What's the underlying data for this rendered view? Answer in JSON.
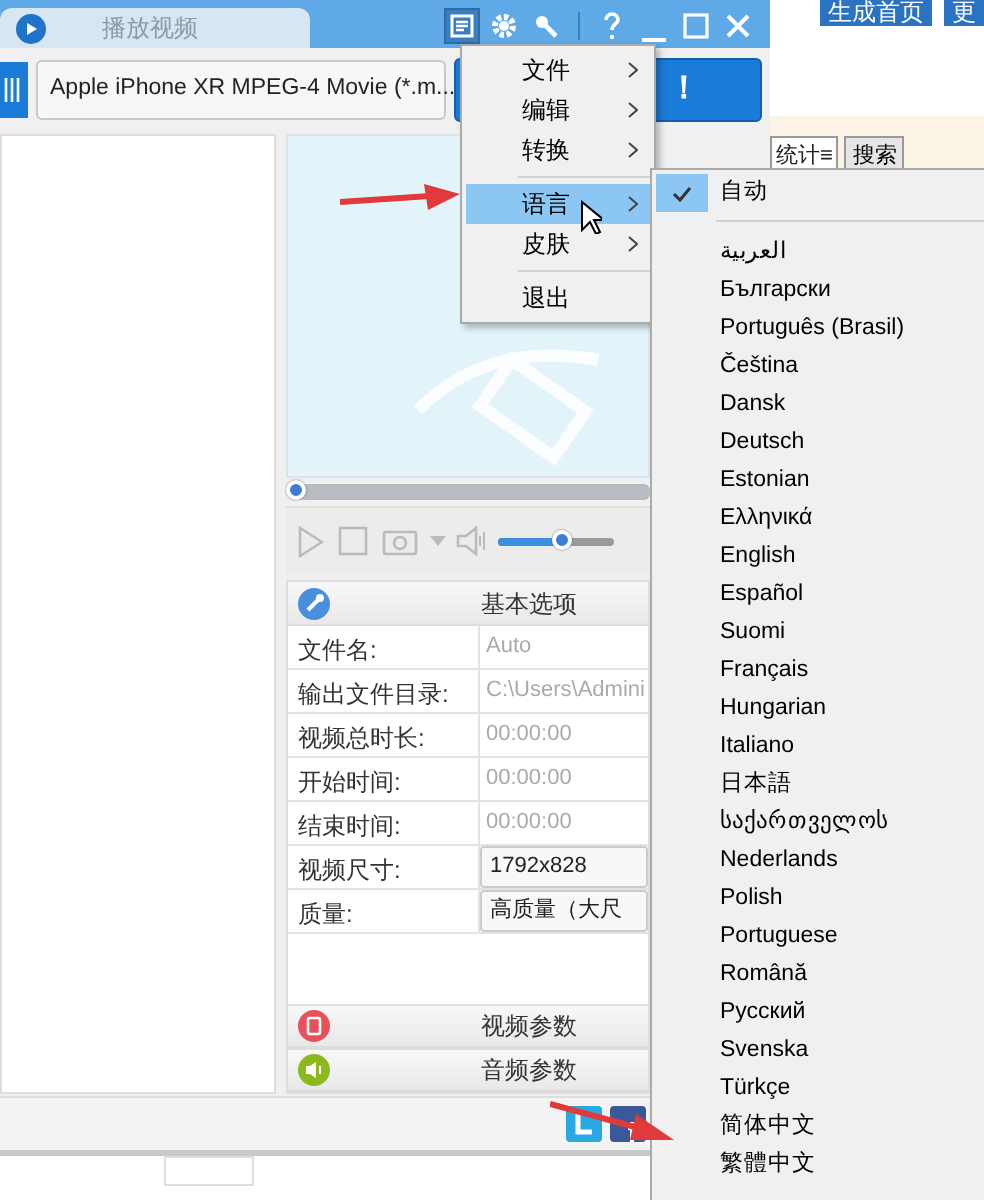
{
  "app": {
    "tab": {
      "label": "播放视频",
      "selected": false
    },
    "format_select": {
      "value": "Apple iPhone XR MPEG-4 Movie (*.m..."
    },
    "convert_button": {
      "label": "！"
    },
    "seek": {
      "level": 0
    },
    "volume": {
      "level": 0.55
    },
    "basic_options": {
      "title": "基本选项",
      "rows": [
        {
          "label": "文件名:",
          "value": "Auto",
          "kind": "text"
        },
        {
          "label": "输出文件目录:",
          "value": "C:\\Users\\Admini",
          "kind": "text"
        },
        {
          "label": "视频总时长:",
          "value": "00:00:00",
          "kind": "text"
        },
        {
          "label": "开始时间:",
          "value": "00:00:00",
          "kind": "text"
        },
        {
          "label": "结束时间:",
          "value": "00:00:00",
          "kind": "text"
        },
        {
          "label": "视频尺寸:",
          "value": "1792x828",
          "kind": "select"
        },
        {
          "label": "质量:",
          "value": "高质量（大尺",
          "kind": "select"
        }
      ]
    },
    "sections": [
      {
        "title": "视频参数",
        "kind": "video"
      },
      {
        "title": "音频参数",
        "kind": "audio"
      }
    ]
  },
  "web_page": {
    "buttons": [
      "生成首页",
      "更"
    ],
    "select": {
      "value": "统计≡"
    },
    "search_button": "搜索"
  },
  "main_menu": {
    "groups": [
      [
        {
          "label": "文件",
          "highlighted": false,
          "submenu": true
        },
        {
          "label": "编辑",
          "highlighted": false,
          "submenu": true
        },
        {
          "label": "转换",
          "highlighted": false,
          "submenu": true
        }
      ],
      [
        {
          "label": "语言",
          "highlighted": true,
          "submenu": true
        },
        {
          "label": "皮肤",
          "highlighted": false,
          "submenu": true
        }
      ],
      [
        {
          "label": "退出",
          "highlighted": false,
          "submenu": false
        }
      ]
    ]
  },
  "language_menu": {
    "groups": [
      [
        {
          "label": "自动",
          "checked": true
        }
      ],
      [
        {
          "label": "العربية",
          "checked": false
        },
        {
          "label": "Български",
          "checked": false
        },
        {
          "label": "Português (Brasil)",
          "checked": false
        },
        {
          "label": "Čeština",
          "checked": false
        },
        {
          "label": "Dansk",
          "checked": false
        },
        {
          "label": "Deutsch",
          "checked": false
        },
        {
          "label": "Estonian",
          "checked": false
        },
        {
          "label": "Ελληνικά",
          "checked": false
        },
        {
          "label": "English",
          "checked": false
        },
        {
          "label": "Español",
          "checked": false
        },
        {
          "label": "Suomi",
          "checked": false
        },
        {
          "label": "Français",
          "checked": false
        },
        {
          "label": "Hungarian",
          "checked": false
        },
        {
          "label": "Italiano",
          "checked": false
        },
        {
          "label": "日本語",
          "checked": false
        },
        {
          "label": "საქართველოს",
          "checked": false
        },
        {
          "label": "Nederlands",
          "checked": false
        },
        {
          "label": "Polish",
          "checked": false
        },
        {
          "label": "Portuguese",
          "checked": false
        },
        {
          "label": "Română",
          "checked": false
        },
        {
          "label": "Русский",
          "checked": false
        },
        {
          "label": "Svenska",
          "checked": false
        },
        {
          "label": "Türkçe",
          "checked": false
        },
        {
          "label": "简体中文",
          "checked": false
        },
        {
          "label": "繁體中文",
          "checked": false
        }
      ]
    ]
  }
}
